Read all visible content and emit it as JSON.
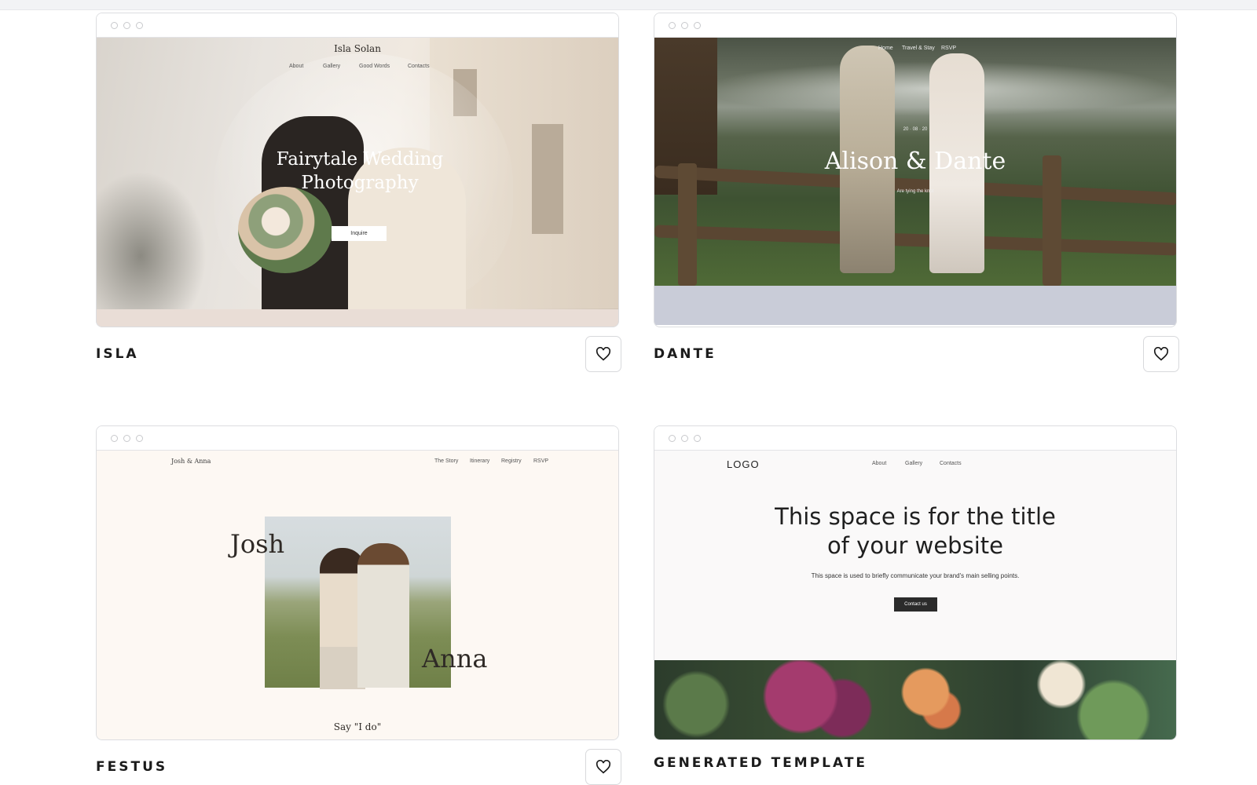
{
  "cards": [
    {
      "name": "ISLA",
      "preview": {
        "site_title": "Isla Solan",
        "nav": [
          "About",
          "Gallery",
          "Good Words",
          "Contacts"
        ],
        "headline": "Fairytale Wedding Photography",
        "button": "Inquire"
      }
    },
    {
      "name": "DANTE",
      "preview": {
        "nav": [
          "Home",
          "Travel & Stay",
          "RSVP"
        ],
        "date": "20 · 08 · 20",
        "headline": "Alison & Dante",
        "subline": "Are tying the knot"
      }
    },
    {
      "name": "FESTUS",
      "preview": {
        "site_title": "Josh & Anna",
        "nav": [
          "The Story",
          "Itinerary",
          "Registry",
          "RSVP"
        ],
        "name_left": "Josh",
        "name_right": "Anna",
        "tagline": "Say \"I do\""
      }
    },
    {
      "name": "GENERATED TEMPLATE",
      "preview": {
        "logo": "LOGO",
        "nav": [
          "About",
          "Gallery",
          "Contacts"
        ],
        "headline_line1": "This space is for the title",
        "headline_line2": "of your website",
        "subline": "This space is used to briefly communicate your brand's main selling points.",
        "button": "Contact us"
      }
    }
  ]
}
